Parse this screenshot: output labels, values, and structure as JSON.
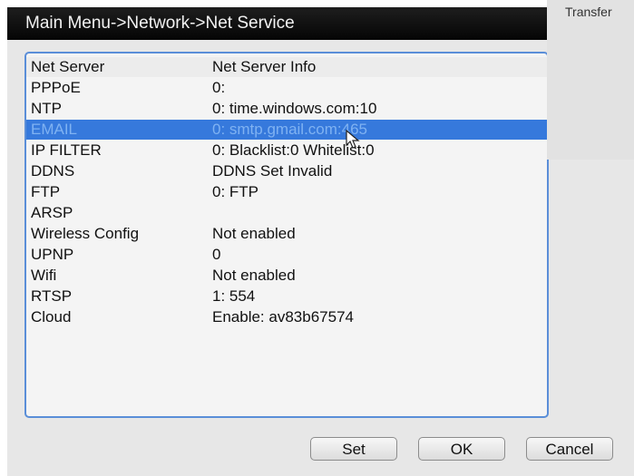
{
  "window": {
    "title": "Main Menu->Network->Net Service"
  },
  "overlay": {
    "text": "Transfer"
  },
  "table": {
    "headers": [
      "Net Server",
      "Net Server Info"
    ],
    "rows": [
      [
        "PPPoE",
        "0:"
      ],
      [
        "NTP",
        "0: time.windows.com:10"
      ],
      [
        "EMAIL",
        "0: smtp.gmail.com:465"
      ],
      [
        "IP FILTER",
        "0: Blacklist:0 Whitelist:0"
      ],
      [
        "DDNS",
        "DDNS Set Invalid"
      ],
      [
        "FTP",
        "0: FTP"
      ],
      [
        "ARSP",
        ""
      ],
      [
        "Wireless Config",
        "Not enabled"
      ],
      [
        "UPNP",
        "0"
      ],
      [
        "Wifi",
        "Not enabled"
      ],
      [
        "RTSP",
        "1: 554"
      ],
      [
        "Cloud",
        "Enable: av83b67574"
      ]
    ],
    "selected_index": 2
  },
  "buttons": {
    "set": "Set",
    "ok": "OK",
    "cancel": "Cancel"
  },
  "colors": {
    "selection": "#3679dc",
    "border": "#5a8ed8",
    "titlebar": "#0d0d0d"
  },
  "icons": {
    "pointer": "mouse-cursor-icon"
  }
}
